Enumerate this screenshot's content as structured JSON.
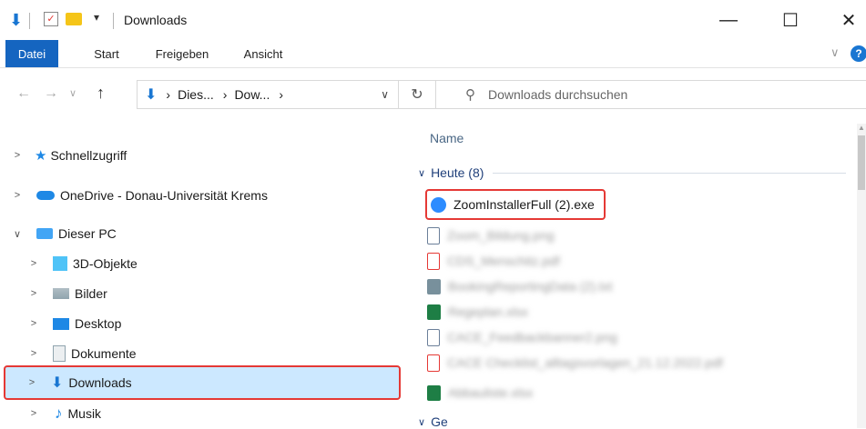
{
  "window": {
    "title": "Downloads"
  },
  "ribbon": {
    "tabs": [
      "Datei",
      "Start",
      "Freigeben",
      "Ansicht"
    ]
  },
  "address": {
    "crumbs": [
      "Dies...",
      "Dow..."
    ],
    "search_placeholder": "Downloads durchsuchen"
  },
  "nav": {
    "quick_access": "Schnellzugriff",
    "onedrive": "OneDrive - Donau-Universität Krems",
    "this_pc": "Dieser PC",
    "items": [
      "3D-Objekte",
      "Bilder",
      "Desktop",
      "Dokumente",
      "Downloads",
      "Musik"
    ]
  },
  "content": {
    "column_name": "Name",
    "group_today": "Heute (8)",
    "group_earlier": "Ge",
    "files": [
      {
        "name": "ZoomInstallerFull (2).exe",
        "icon": "zoom-icon"
      },
      {
        "name": "Zoom_Bildung.png",
        "icon": "image-icon"
      },
      {
        "name": "CDS_Menschitz.pdf",
        "icon": "pdf-icon"
      },
      {
        "name": "BookingReportingData (2).txt",
        "icon": "generic-file-icon"
      },
      {
        "name": "Regeplan.xlsx",
        "icon": "excel-icon"
      },
      {
        "name": "CACE_Feedbackbanner2.png",
        "icon": "image-icon"
      },
      {
        "name": "CACE Checklist_alltagsvorlagen_21.12.2022.pdf",
        "icon": "pdf-icon"
      },
      {
        "name": "Abbauliste.xlsx",
        "icon": "excel-icon"
      }
    ]
  }
}
